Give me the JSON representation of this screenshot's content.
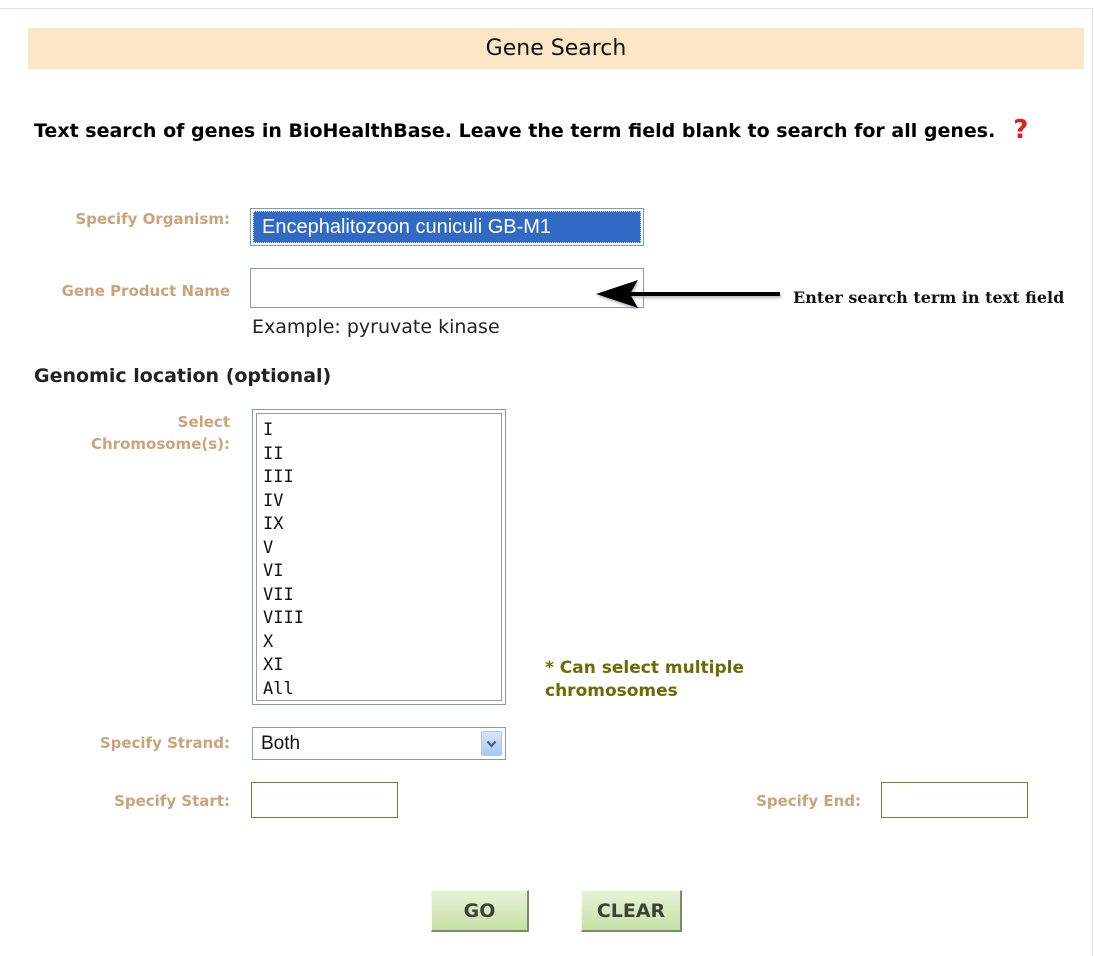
{
  "page": {
    "title": "Gene Search",
    "intro_text": "Text search of genes in BioHealthBase. Leave the term field blank to search for all genes.",
    "help_icon_glyph": "?",
    "help_icon_color": "#e31d1d"
  },
  "form": {
    "organism": {
      "label": "Specify Organism:",
      "selected": "Encephalitozoon cuniculi GB-M1"
    },
    "gene_product": {
      "label": "Gene Product Name",
      "value": "",
      "example": "Example: pyruvate kinase",
      "annotation": "Enter search term in text field"
    },
    "genomic_location": {
      "heading": "Genomic location (optional)",
      "chromosome_label": "Select Chromosome(s):",
      "chromosomes": [
        "I",
        "II",
        "III",
        "IV",
        "IX",
        "V",
        "VI",
        "VII",
        "VIII",
        "X",
        "XI",
        "All"
      ],
      "multi_note": "* Can select multiple chromosomes",
      "strand_label": "Specify Strand:",
      "strand_selected": "Both",
      "start_label": "Specify Start:",
      "start_value": "",
      "end_label": "Specify End:",
      "end_value": ""
    }
  },
  "buttons": {
    "go": "GO",
    "clear": "CLEAR"
  },
  "colors": {
    "title_bar_bg": "#fbe6c6",
    "label_color": "#c9a47a",
    "note_color": "#6f6a06",
    "selected_bg": "#316ac5",
    "button_green": "#c6e0a6"
  }
}
